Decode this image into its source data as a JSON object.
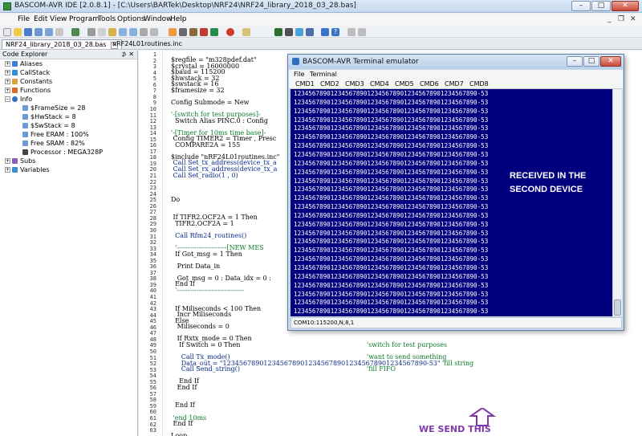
{
  "window": {
    "title": "BASCOM-AVR IDE [2.0.8.1] - [C:\\Users\\BARTek\\Desktop\\NRF24\\NRF24_library_2018_03_28.bas]"
  },
  "menu": [
    "File",
    "Edit",
    "View",
    "Program",
    "Tools",
    "Options",
    "Window",
    "Help"
  ],
  "tabs": [
    "NRF24_library_2018_03_28.bas",
    "nRF24L01routines.inc"
  ],
  "explorer": {
    "title": "Code Explorer",
    "items": [
      "Aliases",
      "CallStack",
      "Constants",
      "Functions",
      "Info",
      "$FrameSize = 28",
      "$HwStack = 8",
      "$SwStack = 8",
      "Free ERAM : 100%",
      "Free SRAM : 82%",
      "Processor : MEGA328P",
      "Subs",
      "Variables"
    ]
  },
  "code": {
    "line_numbers": [
      "1",
      "2",
      "3",
      "4",
      "5",
      "6",
      "7",
      "8",
      "9",
      "10",
      "11",
      "12",
      "13",
      "14",
      "15",
      "16",
      "17",
      "18",
      "19",
      "20",
      "21",
      "22",
      "23",
      "24",
      "25",
      "26",
      "27",
      "28",
      "29",
      "30",
      "31",
      "32",
      "33",
      "34",
      "35",
      "36",
      "37",
      "38",
      "39",
      "40",
      "41",
      "42",
      "43",
      "44",
      "45",
      "46",
      "47",
      "48",
      "49",
      "50",
      "51",
      "52",
      "53",
      "54",
      "55",
      "56",
      "57",
      "58",
      "59",
      "60",
      "61",
      "62",
      "63"
    ],
    "lines": [
      "$regfile = \"m328pdef.dat\"",
      "$crystal = 16000000",
      "$baud = 115200",
      "$hwstack = 32",
      "$swstack = 16",
      "$framesize = 32",
      "Config Submode = New",
      "'-[switch for test purposes]-",
      "  Switch Alias PINC.0 : Config",
      "'-[Timer for 10ms time base]-",
      " Config TIMER2 = Timer , Presc",
      "  COMPARE2A = 155",
      "$include \"nRF24L01routines.inc\"",
      " Call Set_tx_address(device_tx_a",
      " Call Set_rx_address(device_tx_a",
      " Call Set_radio(1 , 0)",
      "Do",
      " If TIFR2.OCF2A = 1 Then",
      "  TIFR2.OCF2A = 1",
      "  Call Rfm24_routines()",
      "  '-----------------------[NEW MES",
      "  If Got_msg = 1 Then",
      "   Print Data_in",
      "   Got_msg = 0 : Data_idx = 0 :",
      "  End If",
      "  '-------------------------------",
      "  If Miliseconds < 100 Then",
      "   Incr Miliseconds",
      "  Else",
      "   Miliseconds = 0",
      "   If Rxtx_mode = 0 Then",
      "    If Switch = 0 Then",
      "'switch for test purposes",
      "     Call Tx_mode()",
      "'want to send something",
      "     Data_out = \"12345678901234567890123456789012345678901234567890-53\"",
      "'fill string",
      "     Call Send_string()",
      "'fill FIFO",
      "    End If",
      "   End If",
      "  End If",
      " 'end 10ms",
      " End If",
      "Loop"
    ]
  },
  "annotation": {
    "send_label": "WE SEND THIS"
  },
  "terminal": {
    "title": "BASCOM-AVR Terminal emulator",
    "menu": [
      "File",
      "Terminal"
    ],
    "commands": [
      "CMD1",
      "CMD2",
      "CMD3",
      "CMD4",
      "CMD5",
      "CMD6",
      "CMD7",
      "CMD8"
    ],
    "received_line": "12345678901234567890123456789012345678901234567890-53",
    "received_label_1": "RECEIVED IN THE",
    "received_label_2": "SECOND DEVICE",
    "status": "COM10:115200,N,8,1"
  },
  "colors": {
    "terminal_bg": "#00007f",
    "annotation": "#7d3aa8"
  }
}
